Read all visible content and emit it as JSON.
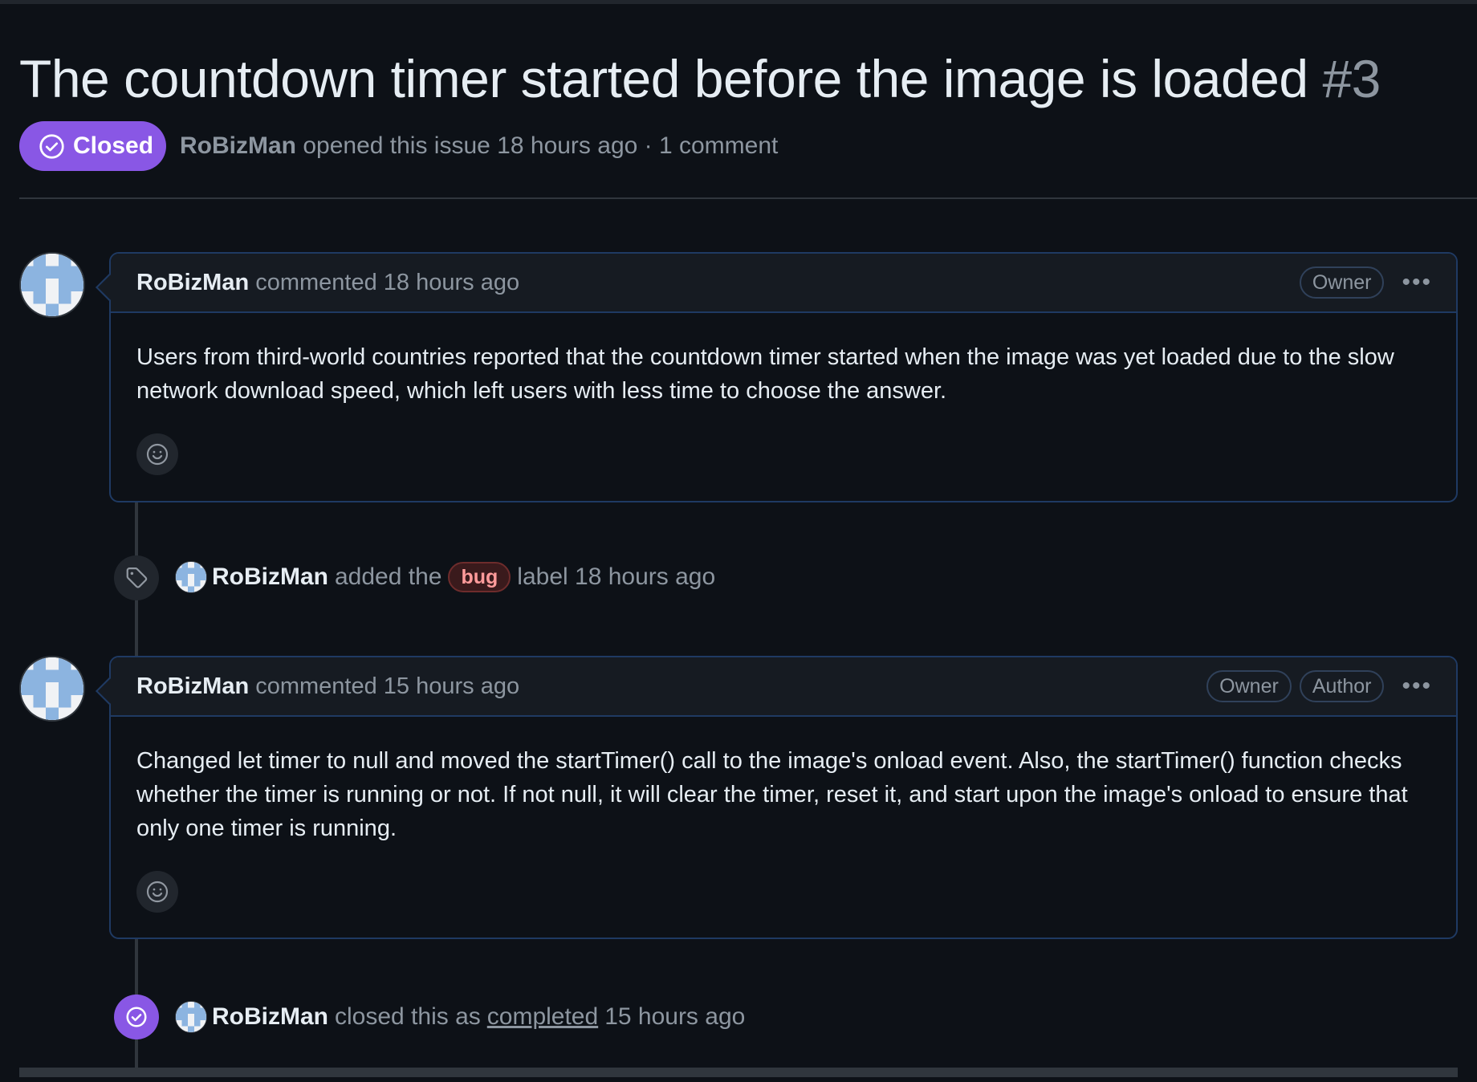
{
  "issue": {
    "title": "The countdown timer started before the image is loaded",
    "number": "#3",
    "state": "Closed",
    "meta": {
      "author": "RoBizMan",
      "opened_text": "opened this issue 18 hours ago · 1 comment"
    }
  },
  "comments": [
    {
      "author": "RoBizMan",
      "action": "commented 18 hours ago",
      "roles": [
        "Owner"
      ],
      "body": "Users from third-world countries reported that the countdown timer started when the image was yet loaded due to the slow network download speed, which left users with less time to choose the answer."
    },
    {
      "author": "RoBizMan",
      "action": "commented 15 hours ago",
      "roles": [
        "Owner",
        "Author"
      ],
      "body": "Changed let timer to null and moved the startTimer() call to the image's onload event. Also, the startTimer() function checks whether the timer is running or not. If not null, it will clear the timer, reset it, and start upon the image's onload to ensure that only one timer is running."
    }
  ],
  "events": {
    "label": {
      "actor": "RoBizMan",
      "pre": "added the",
      "label_name": "bug",
      "post": "label 18 hours ago"
    },
    "closed": {
      "actor": "RoBizMan",
      "pre": "closed this as",
      "link": "completed",
      "post": "15 hours ago"
    }
  },
  "colors": {
    "closed_purple": "#8957e5",
    "bug_label": "#ff9b9b",
    "background": "#0d1117"
  },
  "icons": [
    "check-circle-icon",
    "tag-icon",
    "smiley-icon",
    "kebab-icon"
  ]
}
